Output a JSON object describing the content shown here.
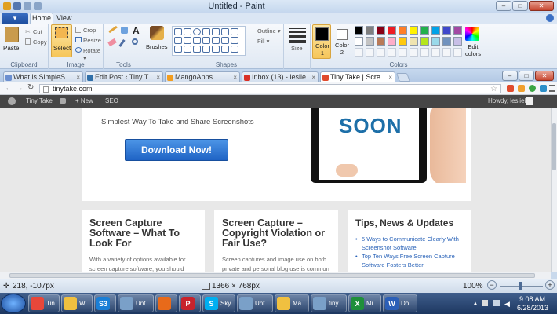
{
  "paint": {
    "title": "Untitled - Paint",
    "tabs": {
      "file": "▾",
      "home": "Home",
      "view": "View"
    },
    "clipboard": {
      "label": "Clipboard",
      "paste": "Paste",
      "cut": "Cut",
      "copy": "Copy"
    },
    "image": {
      "label": "Image",
      "select": "Select",
      "crop": "Crop",
      "resize": "Resize",
      "rotate": "Rotate ▾"
    },
    "tools": {
      "label": "Tools",
      "text_tool": "A"
    },
    "brushes": {
      "label": "Brushes"
    },
    "shapes": {
      "label": "Shapes",
      "outline": "Outline ▾",
      "fill": "Fill ▾"
    },
    "size": {
      "label": "Size"
    },
    "colors": {
      "label": "Colors",
      "color1": "Color\n1",
      "color2": "Color\n2",
      "edit": "Edit colors",
      "color1_value": "#000000",
      "color2_value": "#ffffff",
      "palette_row1": [
        "#000000",
        "#7f7f7f",
        "#880015",
        "#ed1c24",
        "#ff7f27",
        "#fff200",
        "#22b14c",
        "#00a2e8",
        "#3f48cc",
        "#a349a4"
      ],
      "palette_row2": [
        "#ffffff",
        "#c3c3c3",
        "#b97a57",
        "#ffaec9",
        "#ffc90e",
        "#efe4b0",
        "#b5e61d",
        "#99d9ea",
        "#7092be",
        "#c8bfe7"
      ]
    },
    "status": {
      "cursor": "218, -107px",
      "canvas_size": "1366 × 768px",
      "zoom": "100%"
    }
  },
  "browser": {
    "tabs": [
      {
        "label": "What is SimpleS",
        "color": "#6b8fd0"
      },
      {
        "label": "Edit Post ‹ Tiny T",
        "color": "#2f6fa8"
      },
      {
        "label": "MangoApps",
        "color": "#f29d1f"
      },
      {
        "label": "Inbox (13) - leslie",
        "color": "#d93025"
      },
      {
        "label": "Tiny Take | Scre",
        "color": "#e04b2d"
      }
    ],
    "tab_close": "×",
    "url": "tinytake.com"
  },
  "wp_admin": {
    "site": "Tiny Take",
    "new": "+ New",
    "seo": "SEO",
    "greeting": "Howdy, lesliеb"
  },
  "page": {
    "tagline": "Simplest Way To Take and Share Screenshots",
    "download": "Download Now!",
    "hero_image_text": "SOON",
    "cards": [
      {
        "title": "Screen Capture Software – What To Look For",
        "body": "With a variety of options available for screen capture software, you should"
      },
      {
        "title": "Screen Capture – Copyright Violation or Fair Use?",
        "body": "Screen captures and image use on both private and personal blog use is common"
      },
      {
        "title": "Tips, News & Updates",
        "links": [
          "5 Ways to Communicate Clearly With Screenshot Software",
          "Top Ten Ways Free Screen Capture Software Fosters Better"
        ]
      }
    ]
  },
  "taskbar": {
    "items": [
      {
        "label": "Tin",
        "color": "#e8473a"
      },
      {
        "label": "W...",
        "color": "#f0c040"
      },
      {
        "label": "",
        "color": "#1b7fd6",
        "icon_text": "S3"
      },
      {
        "label": "Unt",
        "color": "#7aa0c8"
      },
      {
        "label": "",
        "color": "#e86a1a"
      },
      {
        "label": "",
        "color": "#c8232c",
        "icon_text": "P"
      },
      {
        "label": "Sky",
        "color": "#00aff0",
        "icon_text": "S"
      },
      {
        "label": "Unt",
        "color": "#7aa0c8"
      },
      {
        "label": "Ma",
        "color": "#f0c040"
      },
      {
        "label": "tiny",
        "color": "#7aa0c8"
      },
      {
        "label": "Mi",
        "color": "#1f8f3a",
        "icon_text": "X"
      },
      {
        "label": "Do",
        "color": "#2b5fb7",
        "icon_text": "W"
      }
    ],
    "time": "9:08 AM",
    "date": "6/28/2013"
  }
}
